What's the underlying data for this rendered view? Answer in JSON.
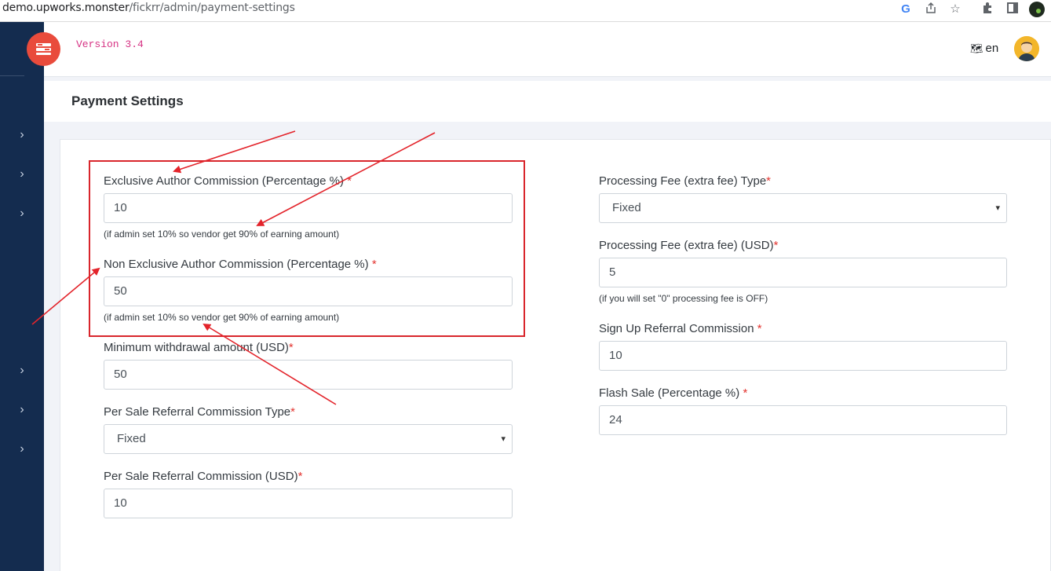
{
  "browser": {
    "url_host": "demo.upworks.monster",
    "url_path": "/fickrr/admin/payment-settings",
    "icons": [
      "google-icon",
      "share-icon",
      "star-icon",
      "extension-icon",
      "sidepanel-icon",
      "profile-icon"
    ]
  },
  "header": {
    "version": "Version 3.4",
    "language": "en"
  },
  "sidebar": {
    "items": [
      "chevron-right-icon",
      "chevron-right-icon",
      "chevron-right-icon",
      "chevron-right-icon",
      "chevron-right-icon",
      "chevron-right-icon"
    ]
  },
  "page": {
    "title": "Payment Settings"
  },
  "form": {
    "left": {
      "exclusive_commission": {
        "label": "Exclusive Author Commission (Percentage %)",
        "required": "*",
        "value": "10",
        "help": "(if admin set 10% so vendor get 90% of earning amount)"
      },
      "non_exclusive_commission": {
        "label": "Non Exclusive Author Commission (Percentage %)",
        "required": "*",
        "value": "50",
        "help": "(if admin set 10% so vendor get 90% of earning amount)"
      },
      "min_withdrawal": {
        "label": "Minimum withdrawal amount (USD)",
        "required": "*",
        "value": "50"
      },
      "per_sale_referral_type": {
        "label": "Per Sale Referral Commission Type",
        "required": "*",
        "value": "Fixed"
      },
      "per_sale_referral_usd": {
        "label": "Per Sale Referral Commission (USD)",
        "required": "*",
        "value": "10"
      }
    },
    "right": {
      "processing_fee_type": {
        "label": "Processing Fee (extra fee) Type",
        "required": "*",
        "value": "Fixed"
      },
      "processing_fee_usd": {
        "label": "Processing Fee (extra fee) (USD)",
        "required": "*",
        "value": "5",
        "help": "(if you will set \"0\" processing fee is OFF)"
      },
      "signup_referral": {
        "label": "Sign Up Referral Commission",
        "required": "*",
        "value": "10"
      },
      "flash_sale": {
        "label": "Flash Sale (Percentage %)",
        "required": "*",
        "value": "24"
      }
    }
  },
  "colors": {
    "sidebar": "#142c4f",
    "logo": "#e94b3c",
    "version": "#d63384",
    "required": "#e3342f",
    "annotation": "#d9262c"
  }
}
